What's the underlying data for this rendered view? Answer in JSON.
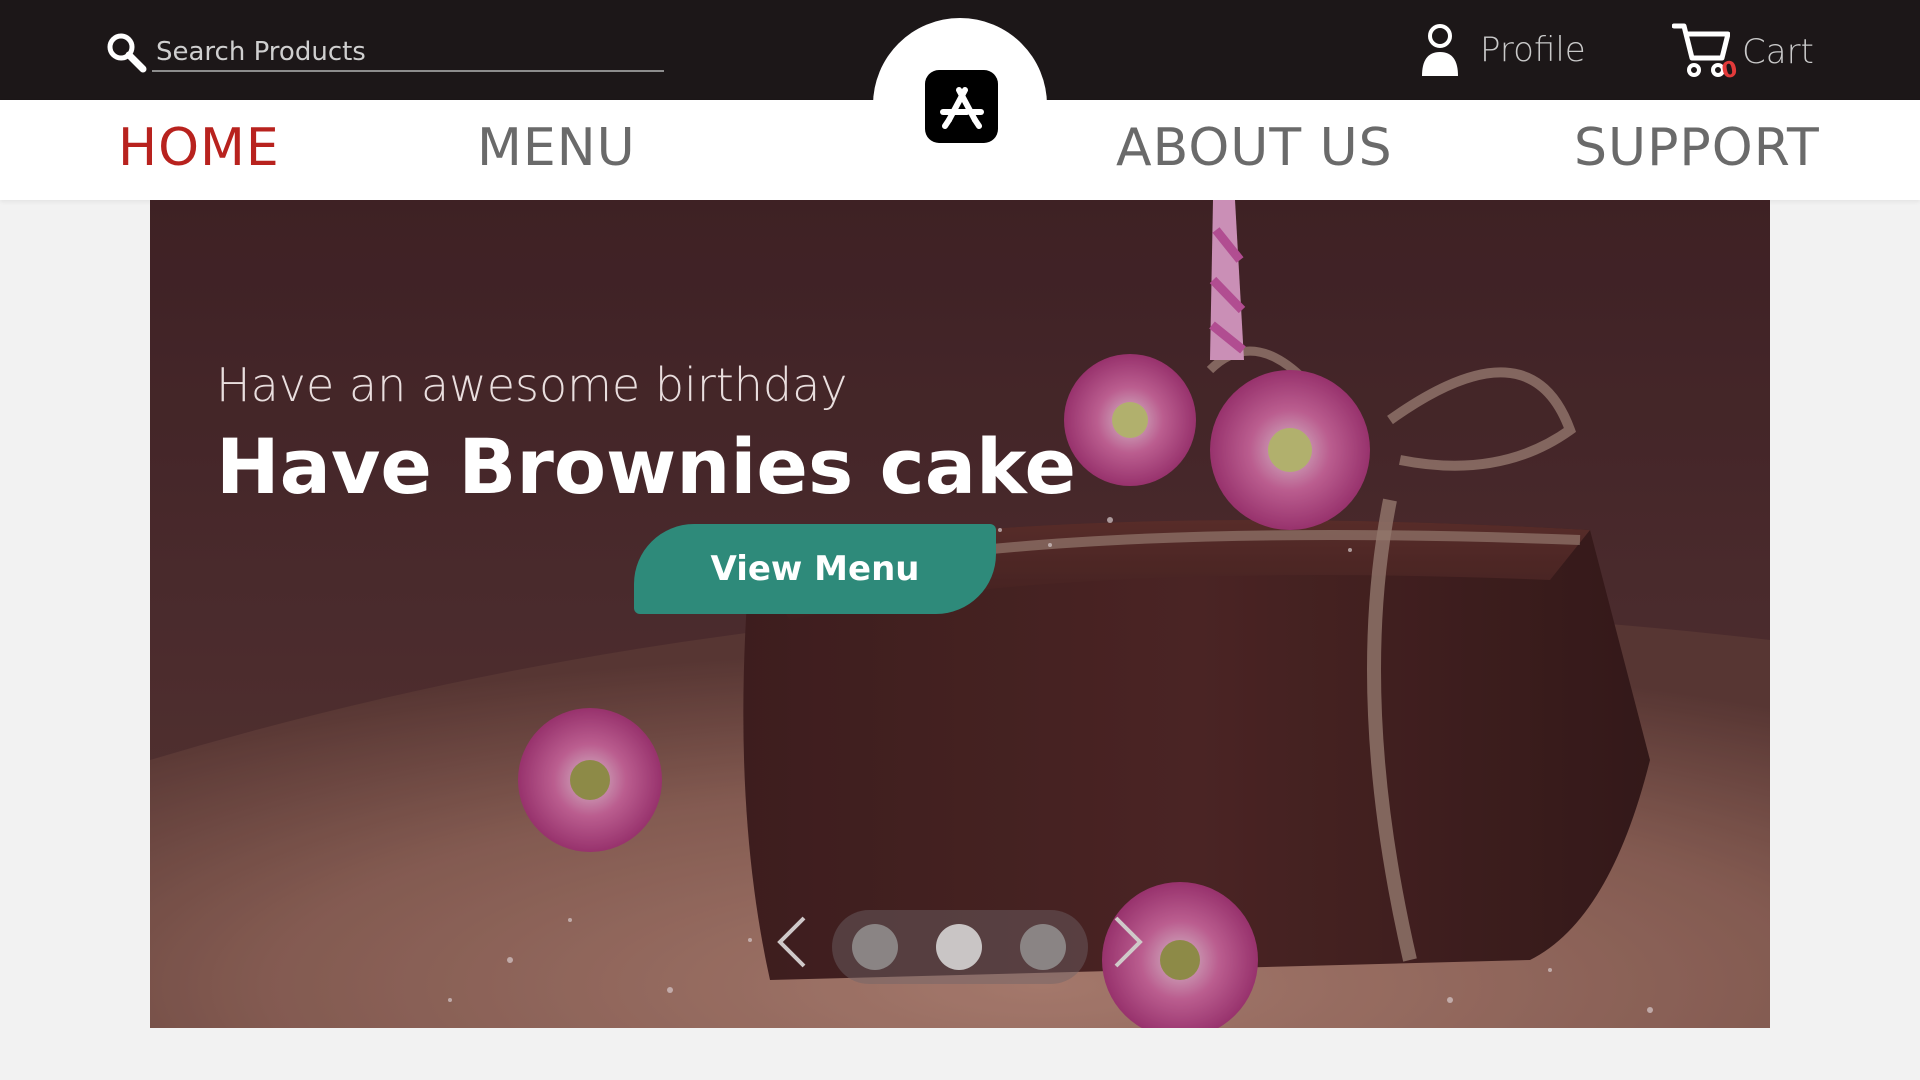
{
  "header": {
    "search": {
      "placeholder": "Search Products",
      "value": ""
    },
    "profile_label": "Profile",
    "cart_label": "Cart",
    "cart_count": "0",
    "search_icon": "search-icon",
    "profile_icon": "user-icon",
    "cart_icon": "cart-icon",
    "logo_icon": "app-store-icon"
  },
  "nav": {
    "items": [
      {
        "label": "HOME",
        "active": true
      },
      {
        "label": "MENU",
        "active": false
      },
      {
        "label": "ABOUT US",
        "active": false
      },
      {
        "label": "SUPPORT",
        "active": false
      }
    ]
  },
  "hero": {
    "subtitle": "Have an awesome birthday",
    "headline": "Have Brownies cake",
    "cta_label": "View Menu",
    "slides_total": 3,
    "active_slide": 2
  },
  "colors": {
    "topbar": "#1c1718",
    "nav_active": "#b8221e",
    "nav_inactive": "#6a6a6a",
    "cta": "#2e8a7a"
  }
}
